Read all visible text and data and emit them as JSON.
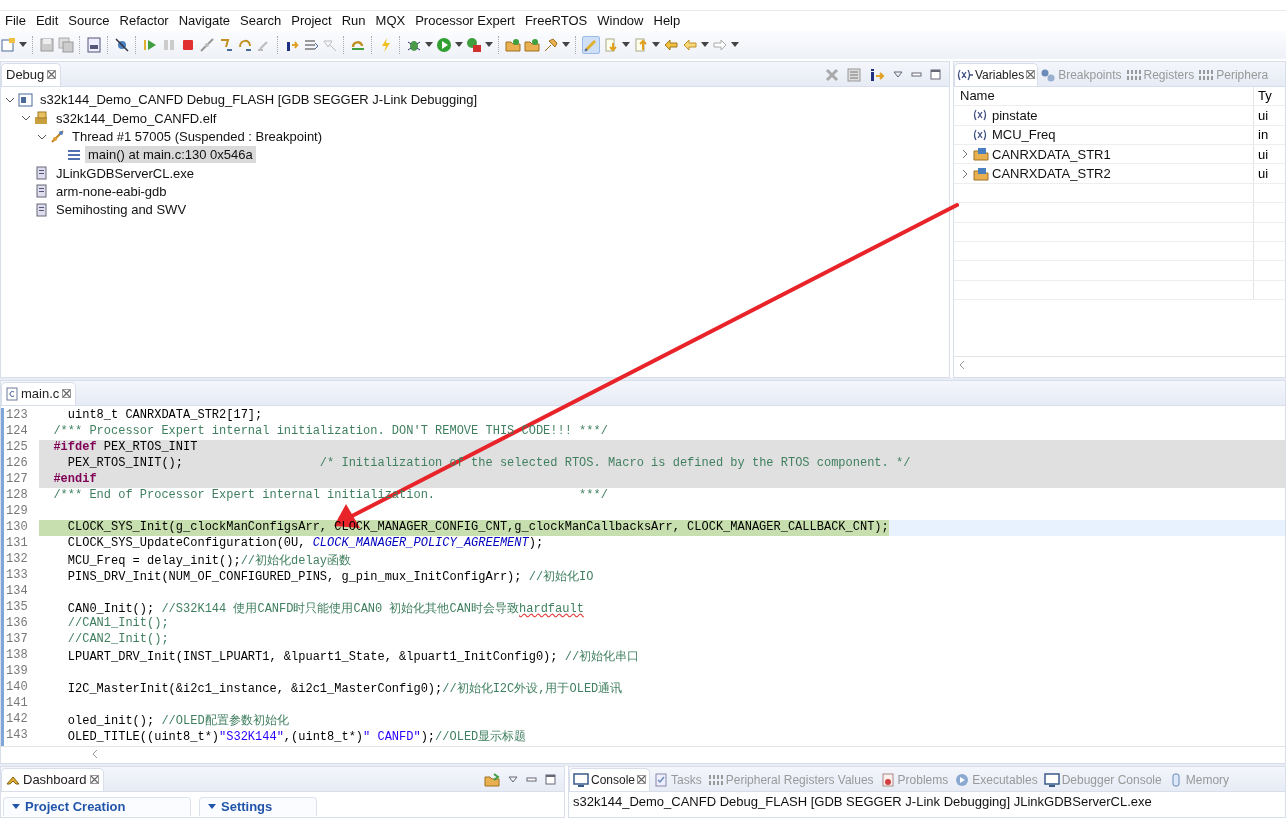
{
  "menu": [
    "File",
    "Edit",
    "Source",
    "Refactor",
    "Navigate",
    "Search",
    "Project",
    "Run",
    "MQX",
    "Processor Expert",
    "FreeRTOS",
    "Window",
    "Help"
  ],
  "debug_panel": {
    "tabs": [
      {
        "label": "Debug",
        "selected": true
      }
    ],
    "tree": [
      {
        "label": "s32k144_Demo_CANFD Debug_FLASH [GDB SEGGER J-Link Debugging]",
        "kind": "launch",
        "selected": false,
        "expanded": true,
        "children": [
          {
            "label": "s32k144_Demo_CANFD.elf",
            "kind": "process",
            "selected": false,
            "expanded": true,
            "children": [
              {
                "label": "Thread #1 57005 (Suspended : Breakpoint)",
                "kind": "thread",
                "selected": false,
                "expanded": true,
                "children": [
                  {
                    "label": "main() at main.c:130 0x546a",
                    "kind": "frame",
                    "selected": true
                  }
                ]
              }
            ]
          },
          {
            "label": "JLinkGDBServerCL.exe",
            "kind": "exe",
            "selected": false
          },
          {
            "label": "arm-none-eabi-gdb",
            "kind": "exe",
            "selected": false
          },
          {
            "label": "Semihosting and SWV",
            "kind": "exe",
            "selected": false
          }
        ]
      }
    ]
  },
  "variables_panel": {
    "tabs": [
      {
        "label": "Variables",
        "kind": "variables",
        "selected": true
      },
      {
        "label": "Breakpoints",
        "kind": "breakpoints",
        "selected": false
      },
      {
        "label": "Registers",
        "kind": "registers",
        "selected": false
      },
      {
        "label": "Periphera",
        "kind": "registers",
        "selected": false
      }
    ],
    "columns": [
      "Name",
      "Ty"
    ],
    "rows": [
      {
        "name": "pinstate",
        "kind": "variable",
        "column_2": "ui"
      },
      {
        "name": "MCU_Freq",
        "kind": "variable",
        "column_2": "in"
      },
      {
        "name": "CANRXDATA_STR1",
        "kind": "struct",
        "expanded": false,
        "column_2": "ui"
      },
      {
        "name": "CANRXDATA_STR2",
        "kind": "struct",
        "expanded": false,
        "column_2": "ui"
      }
    ]
  },
  "editor": {
    "tabs": [
      {
        "label": "main.c",
        "selected": true
      }
    ],
    "lines": [
      {
        "number": "123",
        "current": false,
        "inactive": false,
        "segments": [
          {
            "kind": "code",
            "text": "    uint8_t CANRXDATA_STR2[17];"
          }
        ]
      },
      {
        "number": "124",
        "current": false,
        "inactive": false,
        "segments": [
          {
            "kind": "comment",
            "text": "  /*** Processor Expert internal initialization. DON'T REMOVE THIS CODE!!! ***/"
          }
        ]
      },
      {
        "number": "125",
        "current": false,
        "inactive": true,
        "segments": [
          {
            "kind": "keyword",
            "text": "  #ifdef"
          },
          {
            "kind": "code",
            "text": " PEX_RTOS_INIT"
          }
        ]
      },
      {
        "number": "126",
        "current": false,
        "inactive": true,
        "segments": [
          {
            "kind": "code",
            "text": "    PEX_RTOS_INIT();                   "
          },
          {
            "kind": "comment",
            "text": "/* Initialization of the selected RTOS. Macro is defined by the RTOS component. */"
          }
        ]
      },
      {
        "number": "127",
        "current": false,
        "inactive": true,
        "segments": [
          {
            "kind": "keyword",
            "text": "  #endif"
          }
        ]
      },
      {
        "number": "128",
        "current": false,
        "inactive": false,
        "segments": [
          {
            "kind": "comment",
            "text": "  /*** End of Processor Expert internal initialization.                    ***/"
          }
        ]
      },
      {
        "number": "129",
        "current": false,
        "inactive": false
      },
      {
        "number": "130",
        "current": true,
        "inactive": false,
        "segments": [
          {
            "kind": "code",
            "text": "    CLOCK_SYS_Init(g_clockManConfigsArr, CLOCK_MANAGER_CONFIG_CNT,g_clockManCallbacksArr, CLOCK_MANAGER_CALLBACK_CNT);"
          }
        ]
      },
      {
        "number": "131",
        "current": false,
        "inactive": false,
        "segments": [
          {
            "kind": "code",
            "text": "    CLOCK_SYS_UpdateConfiguration(0U, "
          },
          {
            "kind": "constant",
            "text": "CLOCK_MANAGER_POLICY_AGREEMENT"
          },
          {
            "kind": "code",
            "text": ");"
          }
        ]
      },
      {
        "number": "132",
        "current": false,
        "inactive": false,
        "segments": [
          {
            "kind": "code",
            "text": "    MCU_Freq = delay_init();"
          },
          {
            "kind": "comment",
            "text": "//初始化delay函数"
          }
        ]
      },
      {
        "number": "133",
        "current": false,
        "inactive": false,
        "segments": [
          {
            "kind": "code",
            "text": "    PINS_DRV_Init(NUM_OF_CONFIGURED_PINS, g_pin_mux_InitConfigArr); "
          },
          {
            "kind": "comment",
            "text": "//初始化IO"
          }
        ]
      },
      {
        "number": "134",
        "current": false,
        "inactive": false
      },
      {
        "number": "135",
        "current": false,
        "inactive": false,
        "segments": [
          {
            "kind": "code",
            "text": "    CAN0_Init(); "
          },
          {
            "kind": "comment",
            "text": "//S32K144 使用CANFD时只能使用CAN0 初始化其他CAN时会导致"
          },
          {
            "kind": "misspelled",
            "text": "hardfault"
          }
        ]
      },
      {
        "number": "136",
        "current": false,
        "inactive": false,
        "segments": [
          {
            "kind": "comment",
            "text": "    //CAN1_Init();"
          }
        ]
      },
      {
        "number": "137",
        "current": false,
        "inactive": false,
        "segments": [
          {
            "kind": "comment",
            "text": "    //CAN2_Init();"
          }
        ]
      },
      {
        "number": "138",
        "current": false,
        "inactive": false,
        "segments": [
          {
            "kind": "code",
            "text": "    LPUART_DRV_Init(INST_LPUART1, &lpuart1_State, &lpuart1_InitConfig0); "
          },
          {
            "kind": "comment",
            "text": "//初始化串口"
          }
        ]
      },
      {
        "number": "139",
        "current": false,
        "inactive": false
      },
      {
        "number": "140",
        "current": false,
        "inactive": false,
        "segments": [
          {
            "kind": "code",
            "text": "    I2C_MasterInit(&i2c1_instance, &i2c1_MasterConfig0);"
          },
          {
            "kind": "comment",
            "text": "//初始化I2C外设,用于OLED通讯"
          }
        ]
      },
      {
        "number": "141",
        "current": false,
        "inactive": false
      },
      {
        "number": "142",
        "current": false,
        "inactive": false,
        "segments": [
          {
            "kind": "code",
            "text": "    oled_init(); "
          },
          {
            "kind": "comment",
            "text": "//OLED配置参数初始化"
          }
        ]
      },
      {
        "number": "143",
        "current": false,
        "inactive": false,
        "segments": [
          {
            "kind": "code",
            "text": "    OLED_TITLE((uint8_t*)"
          },
          {
            "kind": "string",
            "text": "\"S32K144\""
          },
          {
            "kind": "code",
            "text": ",(uint8_t*)"
          },
          {
            "kind": "string",
            "text": "\" CANFD\""
          },
          {
            "kind": "code",
            "text": ");"
          },
          {
            "kind": "comment",
            "text": "//OLED显示标题"
          }
        ]
      }
    ]
  },
  "dashboard_panel": {
    "tabs": [
      {
        "label": "Dashboard",
        "selected": true
      }
    ],
    "sections": [
      "Project Creation",
      "Settings"
    ]
  },
  "console_panel": {
    "tabs": [
      {
        "label": "Console",
        "kind": "console",
        "selected": true
      },
      {
        "label": "Tasks",
        "kind": "tasks",
        "selected": false
      },
      {
        "label": "Peripheral Registers Values",
        "kind": "registers",
        "selected": false
      },
      {
        "label": "Problems",
        "kind": "problems",
        "selected": false
      },
      {
        "label": "Executables",
        "kind": "executables",
        "selected": false
      },
      {
        "label": "Debugger Console",
        "kind": "console",
        "selected": false
      },
      {
        "label": "Memory",
        "kind": "memory",
        "selected": false
      }
    ],
    "header": "s32k144_Demo_CANFD Debug_FLASH [GDB SEGGER J-Link Debugging] JLinkGDBServerCL.exe"
  }
}
